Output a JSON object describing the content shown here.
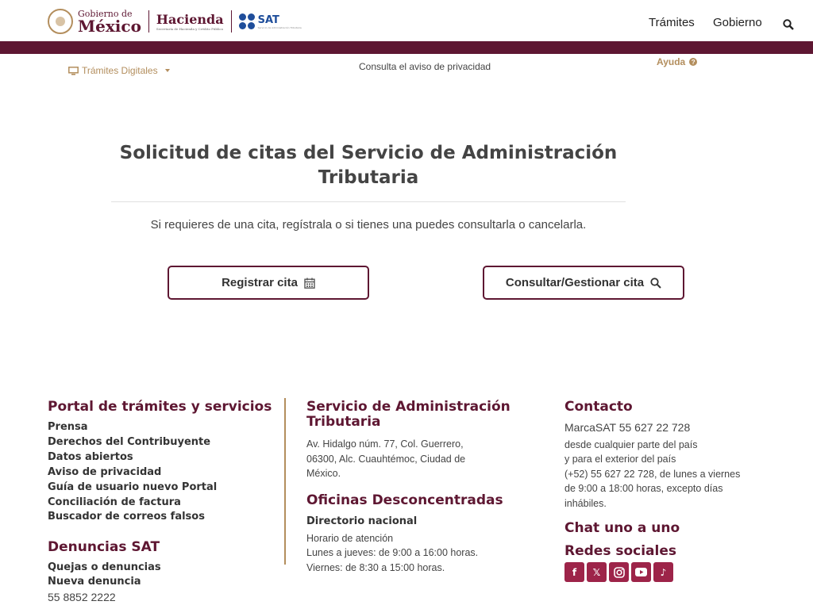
{
  "header": {
    "gob_line1": "Gobierno de",
    "gob_line2": "México",
    "hacienda": "Hacienda",
    "hacienda_sub": "Secretaría de Hacienda y Crédito Público",
    "sat": "SAT",
    "sat_sub": "Servicio de Administración Tributaria",
    "nav": [
      "Trámites",
      "Gobierno"
    ]
  },
  "subnav": {
    "tramites_digitales": "Trámites Digitales",
    "privacy": "Consulta el aviso de privacidad",
    "help": "Ayuda"
  },
  "main": {
    "title": "Solicitud de citas del Servicio de Administración Tributaria",
    "intro": "Si requieres de una cita, regístrala o si tienes una puedes consultarla o cancelarla.",
    "btn_register": "Registrar cita",
    "btn_consult": "Consultar/Gestionar cita"
  },
  "footer": {
    "portal_title": "Portal de trámites y servicios",
    "portal_links": [
      "Prensa",
      "Derechos del Contribuyente",
      "Datos abiertos",
      "Aviso de privacidad",
      "Guía de usuario nuevo Portal",
      "Conciliación de factura",
      "Buscador de correos falsos"
    ],
    "denuncias_title": "Denuncias SAT",
    "denuncias_links": [
      "Quejas o denuncias",
      "Nueva denuncia"
    ],
    "denuncias_phone": "55 8852 2222",
    "sat_title": "Servicio de Administración Tributaria",
    "sat_address": [
      "Av. Hidalgo núm. 77, Col. Guerrero,",
      "06300, Alc. Cuauhtémoc, Ciudad de",
      "México."
    ],
    "oficinas_title": "Oficinas Desconcentradas",
    "directorio": "Directorio nacional",
    "horario": [
      "Horario de atención",
      "Lunes a jueves: de 9:00 a 16:00 horas.",
      "Viernes: de 8:30 a 15:00 horas."
    ],
    "contacto_title": "Contacto",
    "contacto_phone": "MarcaSAT 55 627 22 728",
    "contacto_lines": [
      "desde cualquier parte del país",
      "y para el exterior del país",
      "(+52) 55 627 22 728, de lunes a viernes",
      "de 9:00 a 18:00 horas, excepto días",
      "inhábiles."
    ],
    "chat_title": "Chat uno a uno",
    "redes_title": "Redes sociales",
    "social_icons": [
      "facebook-icon",
      "x-icon",
      "instagram-icon",
      "youtube-icon",
      "tiktok-icon"
    ]
  }
}
